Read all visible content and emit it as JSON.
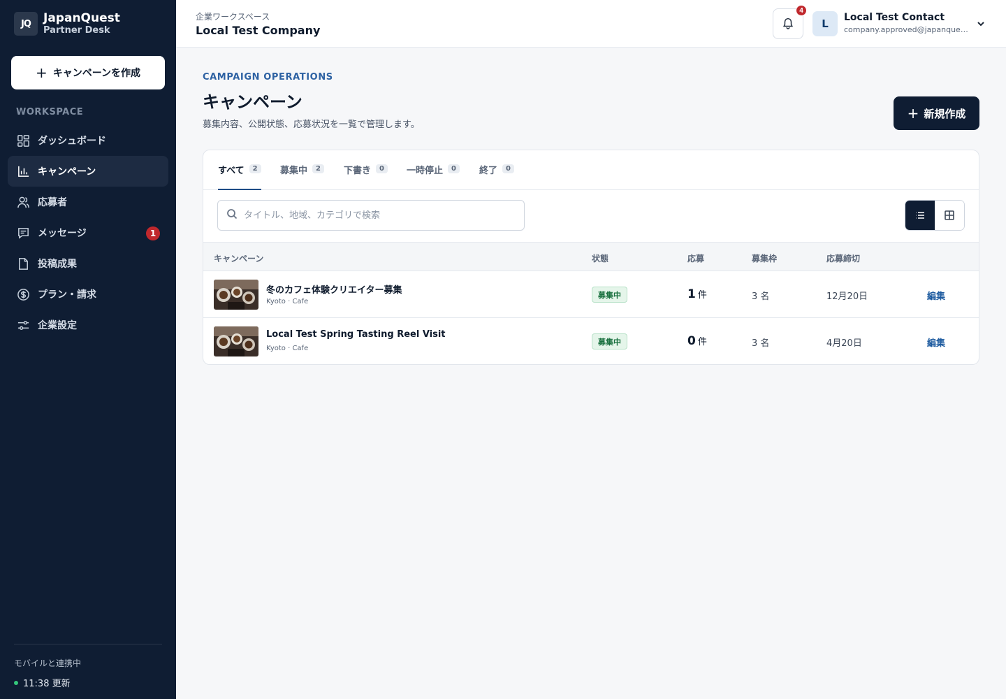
{
  "brand": {
    "logo": "JQ",
    "name": "JapanQuest",
    "sub": "Partner Desk"
  },
  "sidebar": {
    "create_label": "キャンペーンを作成",
    "section_label": "WORKSPACE",
    "items": [
      {
        "label": "ダッシュボード",
        "icon": "dashboard-icon"
      },
      {
        "label": "キャンペーン",
        "icon": "bar-chart-icon",
        "active": true
      },
      {
        "label": "応募者",
        "icon": "users-icon"
      },
      {
        "label": "メッセージ",
        "icon": "message-icon",
        "badge": "1"
      },
      {
        "label": "投稿成果",
        "icon": "document-icon"
      },
      {
        "label": "プラン・請求",
        "icon": "dollar-icon"
      },
      {
        "label": "企業設定",
        "icon": "settings-sliders-icon"
      }
    ],
    "footer": {
      "sync_label": "モバイルと連携中",
      "sync_time": "11:38 更新",
      "status_color": "#34c77b"
    }
  },
  "topbar": {
    "workspace_label": "企業ワークスペース",
    "company_name": "Local Test Company",
    "notification_count": "4",
    "user_initial": "L",
    "user_name": "Local Test Contact",
    "user_email": "company.approved@japanquest.local"
  },
  "page": {
    "eyebrow": "CAMPAIGN OPERATIONS",
    "title": "キャンペーン",
    "description": "募集内容、公開状態、応募状況を一覧で管理します。",
    "new_button": "新規作成"
  },
  "tabs": [
    {
      "label": "すべて",
      "count": "2",
      "active": true
    },
    {
      "label": "募集中",
      "count": "2"
    },
    {
      "label": "下書き",
      "count": "0"
    },
    {
      "label": "一時停止",
      "count": "0"
    },
    {
      "label": "終了",
      "count": "0"
    }
  ],
  "search": {
    "placeholder": "タイトル、地域、カテゴリで検索",
    "value": ""
  },
  "table": {
    "headers": {
      "campaign": "キャンペーン",
      "status": "状態",
      "applications": "応募",
      "slots": "募集枠",
      "deadline": "応募締切"
    },
    "rows": [
      {
        "title": "冬のカフェ体験クリエイター募集",
        "meta": "Kyoto · Cafe",
        "status": "募集中",
        "applications": "1",
        "unit": "件",
        "slots": "3 名",
        "deadline": "12月20日",
        "action": "編集"
      },
      {
        "title": "Local Test Spring Tasting Reel Visit",
        "meta": "Kyoto · Cafe",
        "status": "募集中",
        "applications": "0",
        "unit": "件",
        "slots": "3 名",
        "deadline": "4月20日",
        "action": "編集"
      }
    ]
  },
  "colors": {
    "sidebar_bg": "#0f1d33",
    "accent": "#1f5ca0",
    "badge_red": "#c0282d",
    "status_green": "#19703f"
  }
}
